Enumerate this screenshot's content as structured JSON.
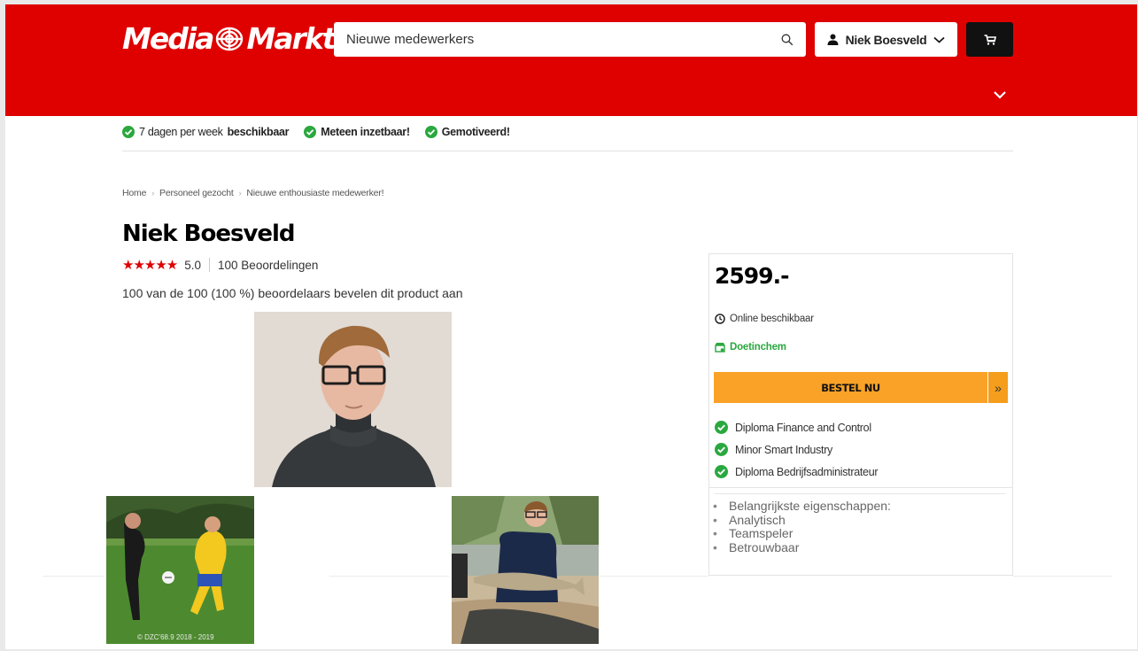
{
  "header": {
    "logo_text": "MediaMarkt",
    "search_value": "Nieuwe medewerkers",
    "account_name": "Niek Boesveld",
    "accent_color": "#df0000"
  },
  "usp": {
    "item1_pre": "7 dagen per week",
    "item1_bold": "beschikbaar",
    "item2": "Meteen inzetbaar!",
    "item3": "Gemotiveerd!"
  },
  "breadcrumb": [
    "Home",
    "Personeel gezocht",
    "Nieuwe enthousiaste medewerker!"
  ],
  "product": {
    "title": "Niek Boesveld",
    "stars": "★★★★★",
    "rating": "5.0",
    "reviews": "100 Beoordelingen",
    "recommend": "100 van de 100 (100 %) beoordelaars bevelen dit product aan"
  },
  "photos": {
    "soccer_caption": "© DZC'68.9 2018 - 2019"
  },
  "buybox": {
    "price": "2599.-",
    "availability": "Online beschikbaar",
    "store": "Doetinchem",
    "buy_label": "BESTEL NU",
    "buy_arrow": "»",
    "features": [
      "Diploma Finance and Control",
      "Minor Smart Industry",
      "Diploma Bedrijfsadministrateur"
    ],
    "properties": [
      "Belangrijkste eigenschappen:",
      "Analytisch",
      "Teamspeler",
      "Betrouwbaar"
    ]
  }
}
